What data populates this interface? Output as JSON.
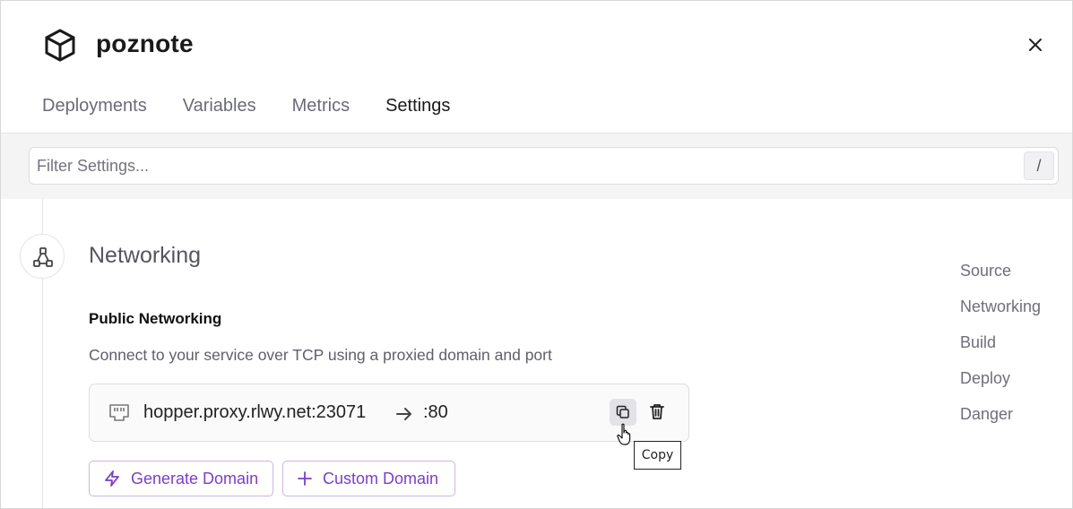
{
  "header": {
    "title": "poznote",
    "logo_icon": "cube-icon",
    "close_icon": "close-icon"
  },
  "tabs": [
    {
      "label": "Deployments",
      "active": false
    },
    {
      "label": "Variables",
      "active": false
    },
    {
      "label": "Metrics",
      "active": false
    },
    {
      "label": "Settings",
      "active": true
    }
  ],
  "filter": {
    "placeholder": "Filter Settings...",
    "shortcut": "/"
  },
  "section": {
    "icon": "network-nodes-icon",
    "title": "Networking",
    "public": {
      "title": "Public Networking",
      "description": "Connect to your service over TCP using a proxied domain and port",
      "proxy_domain": "hopper.proxy.rlwy.net:23071",
      "proxy_port": ":80"
    },
    "tooltip": "Copy",
    "buttons": {
      "generate": "Generate Domain",
      "custom": "Custom Domain"
    }
  },
  "right_nav": [
    "Source",
    "Networking",
    "Build",
    "Deploy",
    "Danger"
  ],
  "colors": {
    "accent": "#7a3fc6",
    "accent_border": "#c9b4e6",
    "muted_text": "#6f6f7a",
    "band_bg": "#f4f4f5"
  }
}
